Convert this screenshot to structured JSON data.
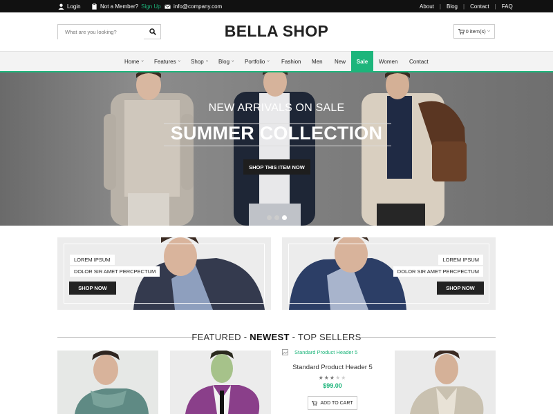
{
  "topbar": {
    "login": "Login",
    "not_member": "Not a Member?",
    "sign_up": "Sign Up",
    "email": "info@company.com",
    "links": [
      "About",
      "Blog",
      "Contact",
      "FAQ"
    ]
  },
  "header": {
    "search_placeholder": "What are you looking?",
    "logo": "BELLA SHOP",
    "cart": "0 item(s)"
  },
  "nav": {
    "items": [
      {
        "label": "Home",
        "dropdown": true
      },
      {
        "label": "Features",
        "dropdown": true
      },
      {
        "label": "Shop",
        "dropdown": true
      },
      {
        "label": "Blog",
        "dropdown": true
      },
      {
        "label": "Portfolio",
        "dropdown": true
      },
      {
        "label": "Fashion",
        "dropdown": false
      },
      {
        "label": "Men",
        "dropdown": false
      },
      {
        "label": "New",
        "dropdown": false
      },
      {
        "label": "Sale",
        "dropdown": false,
        "active": true
      },
      {
        "label": "Women",
        "dropdown": false
      },
      {
        "label": "Contact",
        "dropdown": false
      }
    ]
  },
  "hero": {
    "subtitle": "NEW ARRIVALS ON SALE",
    "title": "SUMMER COLLECTION",
    "button": "SHOP THIS ITEM NOW",
    "slides": 3,
    "active_slide": 3
  },
  "banners": [
    {
      "line1": "LOREM IPSUM",
      "line2": "DOLOR SIR AMET PERCPECTUM",
      "button": "SHOP NOW"
    },
    {
      "line1": "LOREM IPSUM",
      "line2": "DOLOR SIR AMET PERCPECTUM",
      "button": "SHOP NOW"
    }
  ],
  "featured": {
    "prefix": "FEATURED - ",
    "bold": "NEWEST",
    "suffix": " - TOP SELLERS"
  },
  "product": {
    "image_alt": "Standard Product Header 5",
    "name": "Standard Product Header 5",
    "rating": 3,
    "rating_max": 5,
    "price": "$99.00",
    "add_to_cart": "ADD TO CART"
  },
  "colors": {
    "accent": "#1db57b",
    "topbar": "#111111",
    "dark_button": "#222222"
  }
}
